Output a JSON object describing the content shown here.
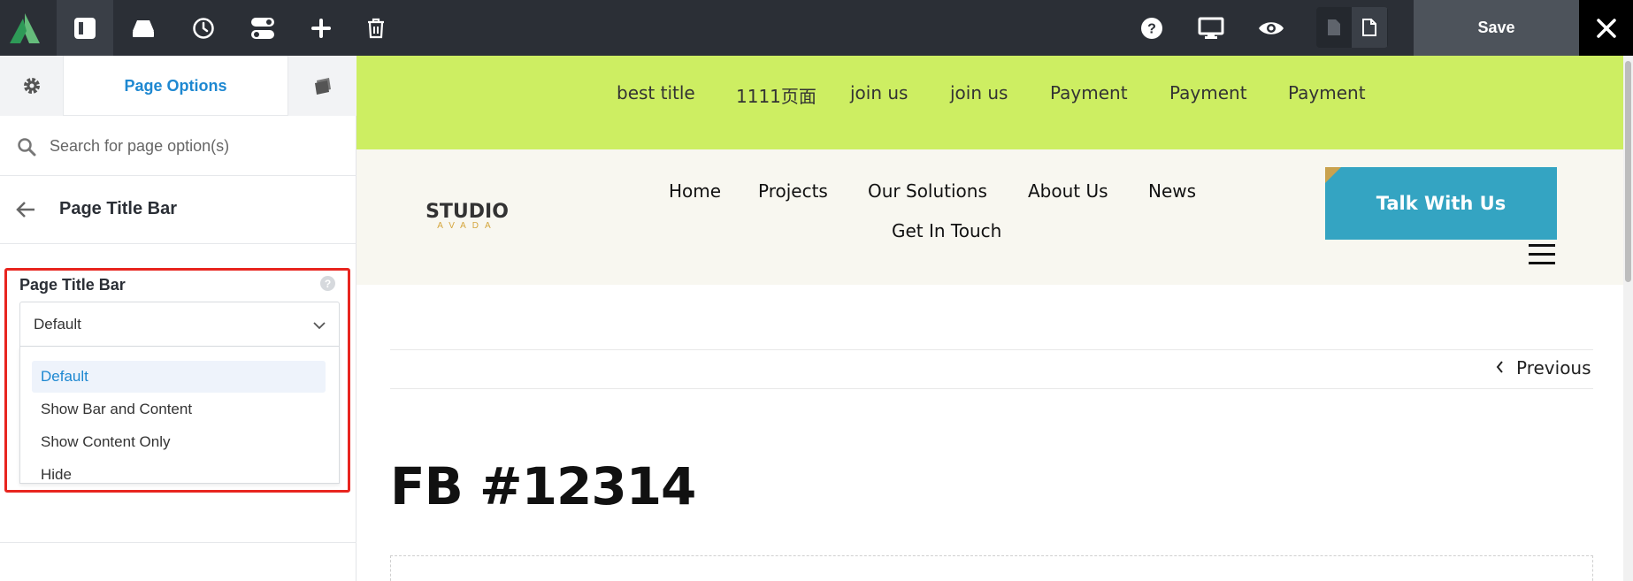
{
  "toolbar": {
    "logo_icon": "avada-logo-icon",
    "icons": [
      "layout-icon",
      "library-icon",
      "history-icon",
      "toggles-icon",
      "add-icon",
      "trash-icon"
    ],
    "right_icons": [
      "help-icon",
      "desktop-icon",
      "preview-eye-icon"
    ],
    "view_toggle": [
      "page-off-icon",
      "page-on-icon"
    ],
    "save_label": "Save",
    "close_icon": "close-icon"
  },
  "sidebar": {
    "tab_title": "Page Options",
    "search_placeholder": "Search for page option(s)",
    "section_title": "Page Title Bar",
    "option": {
      "label": "Page Title Bar",
      "help": "?",
      "selected": "Default",
      "choices": [
        "Default",
        "Show Bar and Content",
        "Show Content Only",
        "Hide"
      ]
    }
  },
  "preview": {
    "top_nav": [
      "best title",
      "1111页面",
      "join us",
      "join us",
      "Payment",
      "Payment",
      "Payment"
    ],
    "brand": {
      "name": "STUDIO",
      "sub": "AVADA"
    },
    "main_nav": [
      "Home",
      "Projects",
      "Our Solutions",
      "About Us",
      "News",
      "Get In Touch"
    ],
    "cta_label": "Talk With Us",
    "prev_label": "Previous",
    "post_title": "FB #12314"
  },
  "colors": {
    "toolbar_bg": "#2b2f36",
    "accent_blue": "#1e88d1",
    "highlight_red": "#e8251f",
    "topnav_green": "#cdee62",
    "cta_teal": "#34a4c2",
    "header_cream": "#f8f7f0"
  }
}
